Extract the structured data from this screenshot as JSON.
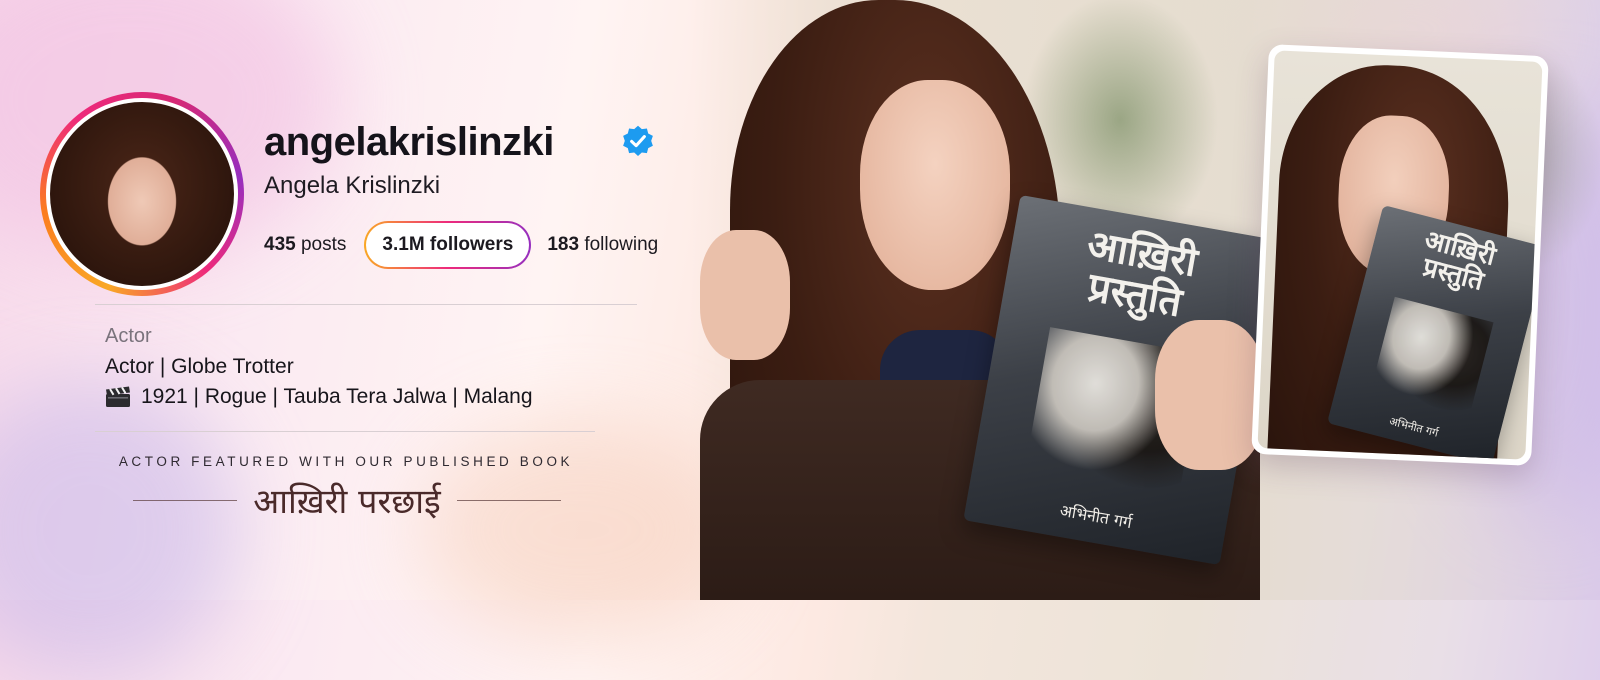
{
  "profile": {
    "username": "angelakrislinzki",
    "full_name": "Angela Krislinzki",
    "verified_icon": "verified-badge-icon",
    "stats": {
      "posts_count": "435",
      "posts_label": "posts",
      "followers_text": "3.1M followers",
      "following_count": "183",
      "following_label": "following"
    },
    "category": "Actor",
    "bio_line1": "Actor | Globe Trotter",
    "bio_icon": "clapperboard-icon",
    "bio_line2": "1921 | Rogue | Tauba Tera Jalwa | Malang"
  },
  "feature": {
    "caption": "ACTOR FEATURED WITH OUR PUBLISHED BOOK",
    "book_name": "आख़िरी परछाई"
  },
  "book_cover": {
    "title_line1": "आख़िरी",
    "title_line2": "प्रस्तुति",
    "author": "अभिनीत गर्ग"
  },
  "colors": {
    "ring_gradient": [
      "#f9a825",
      "#ee2a7b",
      "#962fbf"
    ],
    "verified_blue": "#1d9bf0",
    "text_primary": "#15131a",
    "text_muted": "#7a737c"
  }
}
